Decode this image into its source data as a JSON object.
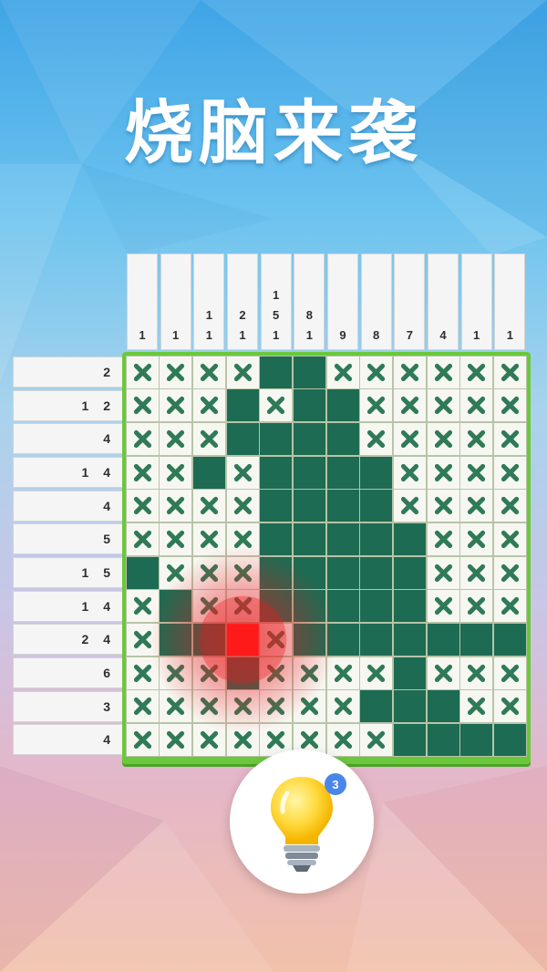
{
  "title": "烧脑来袭",
  "puzzle": {
    "rows": 12,
    "cols": 12,
    "column_clues": [
      [
        "1"
      ],
      [
        "1"
      ],
      [
        "1",
        "1"
      ],
      [
        "2",
        "1"
      ],
      [
        "1",
        "5",
        "1"
      ],
      [
        "8",
        "1"
      ],
      [
        "9"
      ],
      [
        "8"
      ],
      [
        "7"
      ],
      [
        "4"
      ],
      [
        "1"
      ],
      [
        "1"
      ]
    ],
    "row_clues": [
      "2",
      "1 2",
      "4",
      "1 4",
      "4",
      "5",
      "1 5",
      "1 4",
      "2 4",
      "6",
      "3",
      "4"
    ],
    "grid": [
      "XXXX##XXXXXX",
      "XXX#X##XXXXX",
      "XXX####XXXXX",
      "XX#X####XXXX",
      "XXXX####XXXX",
      "XXXX#####XXX",
      "#XXX#####XXX",
      "X#XX#####XXX",
      "X##XX#######",
      "XXX#XXXX#XXX",
      "XXXXXXX###XX",
      "XXXXXXXX####"
    ]
  },
  "selected_cell": {
    "row": 8,
    "col": 3
  },
  "colors": {
    "filled": "#1d6b52",
    "cross": "#2f7a57",
    "board_border": "#6bc83a",
    "highlight": "#e8191e",
    "hint_badge": "#4a86e8"
  },
  "hint": {
    "icon": "lightbulb-icon",
    "count": "3"
  }
}
